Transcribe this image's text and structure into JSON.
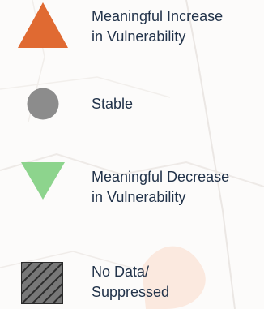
{
  "legend": {
    "items": [
      {
        "symbol": "triangle-up-icon",
        "color": "#e06a32",
        "line1": "Meaningful Increase",
        "line2": "in Vulnerability"
      },
      {
        "symbol": "circle-icon",
        "color": "#8c8c8c",
        "line1": "Stable",
        "line2": ""
      },
      {
        "symbol": "triangle-down-icon",
        "color": "#8dd48d",
        "line1": "Meaningful Decrease",
        "line2": "in Vulnerability"
      },
      {
        "symbol": "hatched-square-icon",
        "color": "#777777",
        "line1": "No Data/",
        "line2": "Suppressed"
      }
    ]
  }
}
